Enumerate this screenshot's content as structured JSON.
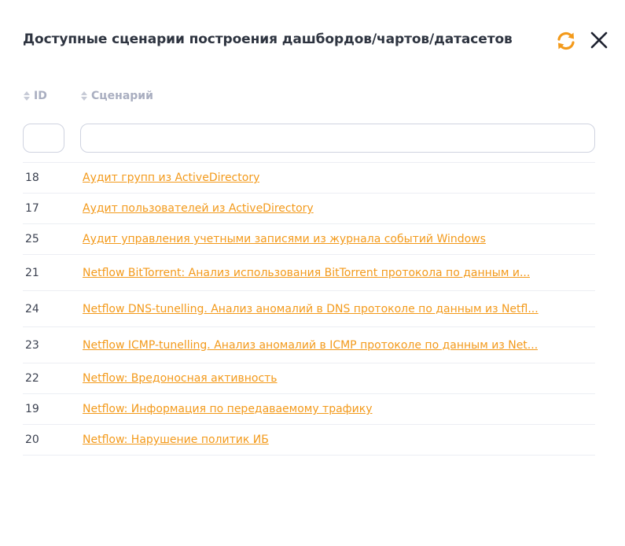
{
  "dialog": {
    "title": "Доступные сценарии построения дашбордов/чартов/датасетов",
    "accent_color": "#f39a1b"
  },
  "table": {
    "columns": [
      {
        "label": "ID"
      },
      {
        "label": "Сценарий"
      }
    ],
    "filters": {
      "id_value": "",
      "scenario_value": ""
    },
    "rows": [
      {
        "id": "18",
        "name": "Аудит групп из ActiveDirectory"
      },
      {
        "id": "17",
        "name": "Аудит пользователей из ActiveDirectory"
      },
      {
        "id": "25",
        "name": "Аудит управления учетными записями из журнала событий Windows"
      },
      {
        "id": "21",
        "name": "Netflow BitTorrent: Анализ использования BitTorrent протокола по данным и..."
      },
      {
        "id": "24",
        "name": "Netflow DNS-tunelling. Анализ аномалий в DNS протоколе по данным из Netfl..."
      },
      {
        "id": "23",
        "name": "Netflow ICMP-tunelling. Анализ аномалий в ICMP протоколе по данным из Net..."
      },
      {
        "id": "22",
        "name": "Netflow: Вредоносная активность"
      },
      {
        "id": "19",
        "name": "Netflow: Информация по передаваемому трафику"
      },
      {
        "id": "20",
        "name": "Netflow: Нарушение политик ИБ"
      }
    ]
  }
}
